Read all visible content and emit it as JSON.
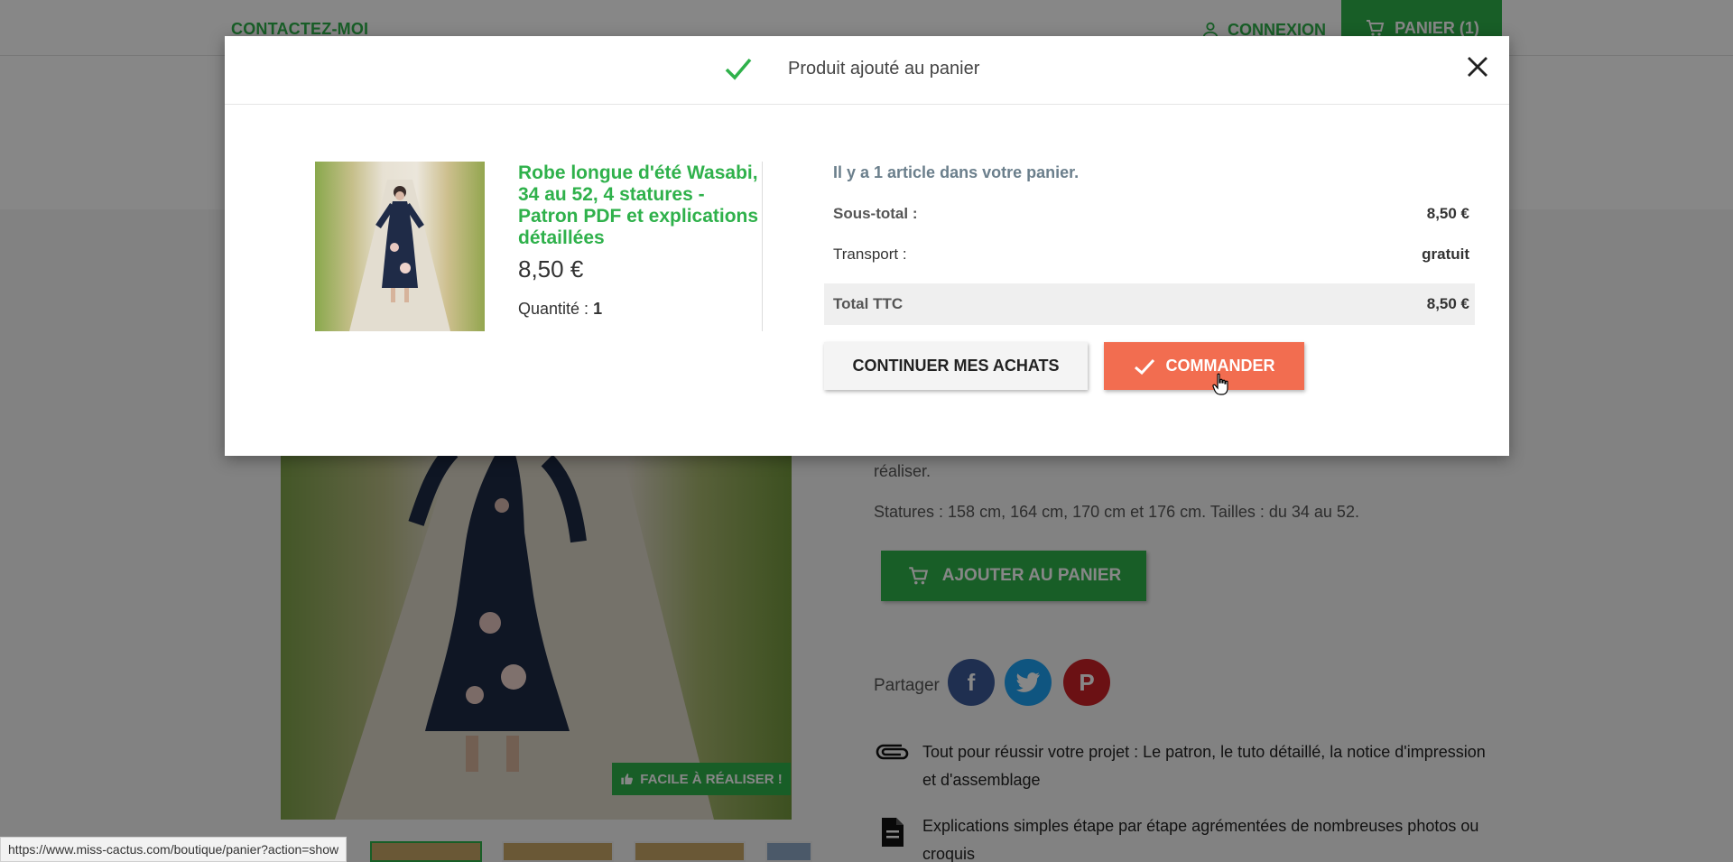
{
  "topbar": {
    "contact": "CONTACTEZ-MOI",
    "login": "CONNEXION",
    "cart": "PANIER (1)"
  },
  "product_page": {
    "desc_line1": "réaliser.",
    "desc_line2": "Statures : 158 cm, 164 cm, 170 cm et 176 cm. Tailles : du 34 au 52.",
    "add_to_cart": "AJOUTER AU PANIER",
    "share_label": "Partager",
    "badge": "FACILE À RÉALISER !",
    "features": [
      {
        "icon": "paperclip-icon",
        "text": "Tout pour réussir votre projet : Le patron, le tuto détaillé, la notice d'impression et d'assemblage"
      },
      {
        "icon": "document-icon",
        "text": "Explications simples étape par étape agrémentées de nombreuses photos ou croquis"
      }
    ]
  },
  "status_bar": {
    "url": "https://www.miss-cactus.com/boutique/panier?action=show"
  },
  "modal": {
    "title": "Produit ajouté au panier",
    "product": {
      "name": "Robe longue d'été Wasabi, 34 au 52, 4 statures - Patron PDF et explications détaillées",
      "price": "8,50 €",
      "quantity_label": "Quantité :",
      "quantity": "1"
    },
    "summary": {
      "count_text": "Il y a 1 article dans votre panier.",
      "subtotal_label": "Sous-total :",
      "subtotal_value": "8,50 €",
      "shipping_label": "Transport :",
      "shipping_value": "gratuit",
      "total_label": "Total TTC",
      "total_value": "8,50 €"
    },
    "buttons": {
      "continue": "CONTINUER MES ACHATS",
      "order": "COMMANDER"
    }
  },
  "colors": {
    "accent_green": "#2fb14b",
    "order_orange": "#f26d50",
    "summary_grey_blue": "#6b7f8c"
  }
}
